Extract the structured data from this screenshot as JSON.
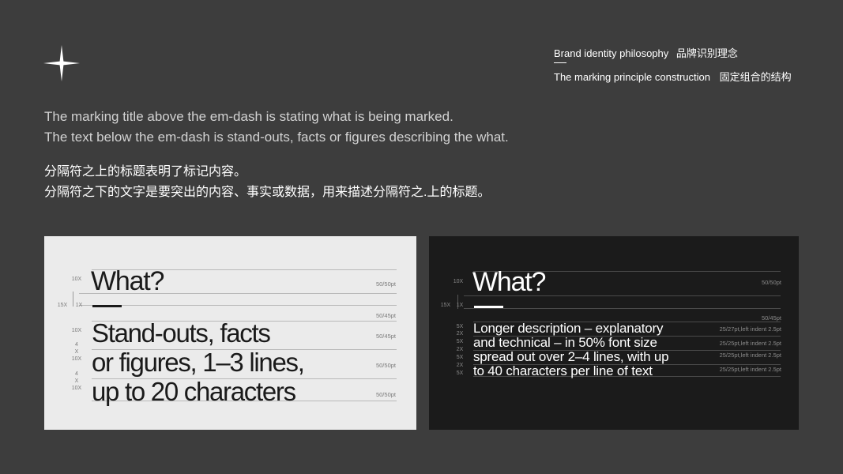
{
  "header": {
    "philosophy_en": "Brand identity philosophy",
    "philosophy_zh": "品牌识别理念",
    "principle_en": "The marking principle construction",
    "principle_zh": "固定组合的结构"
  },
  "intro": {
    "en_line1": "The marking title above the em-dash is stating what is being marked.",
    "en_line2": "The text below the em-dash is stand-outs, facts or figures describing the what.",
    "zh_line1": "分隔符之上的标题表明了标记内容。",
    "zh_line2": "分隔符之下的文字是要突出的内容、事实或数据，用来描述分隔符之.上的标题。"
  },
  "light_panel": {
    "title": "What?",
    "lines": [
      "Stand-outs, facts",
      "or figures, 1–3 lines,",
      "up to 20 characters"
    ],
    "left_marks": [
      "10X",
      "15X",
      "1X",
      "10X",
      "4",
      "X",
      "10X",
      "4",
      "X",
      "10X"
    ],
    "right_marks": [
      "50/50pt",
      "50/45pt",
      "50/45pt",
      "50/50pt",
      "50/50pt"
    ]
  },
  "dark_panel": {
    "title": "What?",
    "lines": [
      "Longer description – explanatory",
      "and technical – in 50% font size",
      "spread out over 2–4 lines, with up",
      "to  40 characters per line of text"
    ],
    "left_marks": [
      "10X",
      "15X",
      "1X",
      "5X",
      "2X",
      "5X",
      "2X",
      "5X",
      "2X",
      "5X"
    ],
    "right_marks": [
      "50/50pt",
      "50/45pt",
      "25/27pt,left indent 2.5pt",
      "25/25pt,left indent 2.5pt",
      "25/25pt,left indent 2.5pt",
      "25/25pt,left indent 2.5pt"
    ]
  },
  "colors": {
    "background": "#3d3d3d",
    "light_panel": "#ebebeb",
    "dark_panel": "#1b1b1b"
  },
  "icons": {
    "logo": "four-point-star-icon"
  }
}
